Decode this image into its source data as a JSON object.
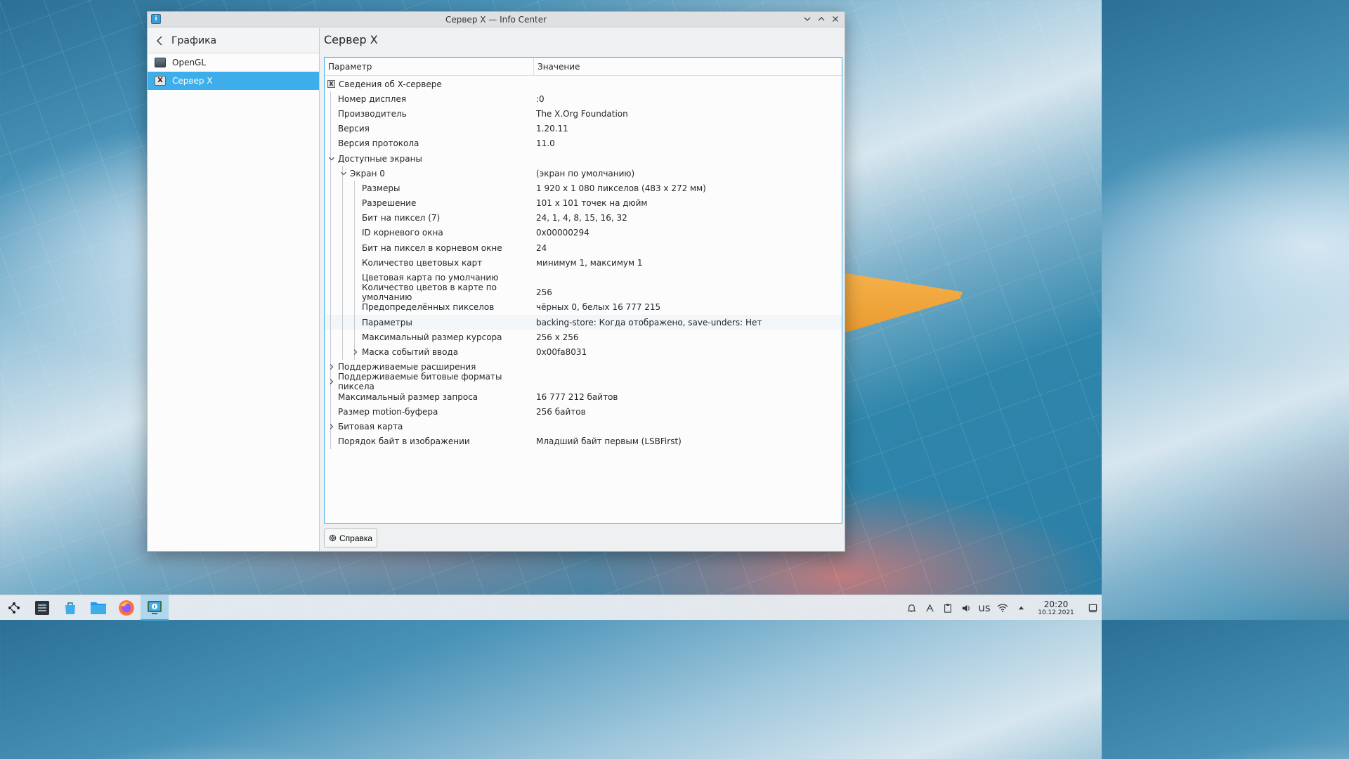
{
  "window": {
    "title": "Сервер X — Info Center"
  },
  "sidebar": {
    "back_label": "Графика",
    "items": [
      {
        "label": "OpenGL",
        "selected": false
      },
      {
        "label": "Сервер X",
        "selected": true
      }
    ]
  },
  "main": {
    "title": "Сервер X",
    "columns": [
      "Параметр",
      "Значение"
    ],
    "rows": [
      {
        "name": "Сведения об X-сервере",
        "value": "",
        "depth": 0,
        "expander": "none",
        "icon": "x-server-icon"
      },
      {
        "name": "Номер дисплея",
        "value": ":0",
        "depth": 1,
        "expander": "none"
      },
      {
        "name": "Производитель",
        "value": "The X.Org Foundation",
        "depth": 1,
        "expander": "none"
      },
      {
        "name": "Версия",
        "value": "1.20.11",
        "depth": 1,
        "expander": "none"
      },
      {
        "name": "Версия протокола",
        "value": "11.0",
        "depth": 1,
        "expander": "none"
      },
      {
        "name": "Доступные экраны",
        "value": "",
        "depth": 1,
        "expander": "expanded"
      },
      {
        "name": "Экран 0",
        "value": "(экран по умолчанию)",
        "depth": 2,
        "expander": "expanded"
      },
      {
        "name": "Размеры",
        "value": "1 920 x 1 080 пикселов (483 x 272 мм)",
        "depth": 3,
        "expander": "none"
      },
      {
        "name": "Разрешение",
        "value": "101 x 101 точек на дюйм",
        "depth": 3,
        "expander": "none"
      },
      {
        "name": "Бит на пиксел (7)",
        "value": "24, 1, 4, 8, 15, 16, 32",
        "depth": 3,
        "expander": "none"
      },
      {
        "name": "ID корневого окна",
        "value": "0x00000294",
        "depth": 3,
        "expander": "none"
      },
      {
        "name": "Бит на пиксел в корневом окне",
        "value": "24",
        "depth": 3,
        "expander": "none"
      },
      {
        "name": "Количество цветовых карт",
        "value": "минимум 1, максимум 1",
        "depth": 3,
        "expander": "none"
      },
      {
        "name": "Цветовая карта по умолчанию",
        "value": "",
        "depth": 3,
        "expander": "none"
      },
      {
        "name": "Количество цветов в карте по умолчанию",
        "value": "256",
        "depth": 3,
        "expander": "none"
      },
      {
        "name": "Предопределённых пикселов",
        "value": "чёрных 0, белых 16 777 215",
        "depth": 3,
        "expander": "none"
      },
      {
        "name": "Параметры",
        "value": "backing-store: Когда отображено, save-unders: Нет",
        "depth": 3,
        "expander": "none",
        "highlight": true
      },
      {
        "name": "Максимальный размер курсора",
        "value": "256 x 256",
        "depth": 3,
        "expander": "none"
      },
      {
        "name": "Маска событий ввода",
        "value": "0x00fa8031",
        "depth": 3,
        "expander": "collapsed"
      },
      {
        "name": "Поддерживаемые расширения",
        "value": "",
        "depth": 1,
        "expander": "collapsed"
      },
      {
        "name": "Поддерживаемые битовые форматы пиксела",
        "value": "",
        "depth": 1,
        "expander": "collapsed"
      },
      {
        "name": "Максимальный размер запроса",
        "value": "16 777 212 байтов",
        "depth": 1,
        "expander": "none"
      },
      {
        "name": "Размер motion-буфера",
        "value": "256 байтов",
        "depth": 1,
        "expander": "none"
      },
      {
        "name": "Битовая карта",
        "value": "",
        "depth": 1,
        "expander": "collapsed"
      },
      {
        "name": "Порядок байт в изображении",
        "value": "Младший байт первым (LSBFirst)",
        "depth": 1,
        "expander": "none"
      }
    ],
    "help_button": "Справка"
  },
  "taskbar": {
    "apps": [
      "application-launcher-icon",
      "system-settings-icon",
      "discover-store-icon",
      "file-manager-icon",
      "firefox-icon",
      "info-center-icon"
    ],
    "keyboard_layout": "us",
    "time": "20:20",
    "date": "10.12.2021"
  },
  "colors": {
    "accent": "#3daee9",
    "window_bg": "#eff0f1",
    "view_bg": "#fcfcfc"
  }
}
